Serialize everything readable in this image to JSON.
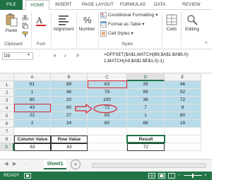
{
  "ribbon_tabs": {
    "file": "FILE",
    "home": "HOME",
    "insert": "INSERT",
    "page_layout": "PAGE LAYOUT",
    "formulas": "FORMULAS",
    "data": "DATA",
    "review": "REVIEW"
  },
  "clipboard": {
    "paste": "Paste",
    "label": "Clipboard"
  },
  "font": {
    "label": "Font"
  },
  "alignment": {
    "label": "Alignment"
  },
  "number": {
    "label": "Number"
  },
  "styles": {
    "conditional_formatting": "Conditional Formatting",
    "format_as_table": "Format as Table",
    "cell_styles": "Cell Styles",
    "label": "Styles"
  },
  "cells": {
    "label": "Cells"
  },
  "editing": {
    "label": "Editing"
  },
  "formula_bar": {
    "name_box": "D9",
    "formula_line1": "=OFFSET($A$1,MATCH(B9,$A$1:$A$6,0)-",
    "formula_line2": "1,MATCH(A9,$A$1:$E$1,0)-1)"
  },
  "columns": [
    "A",
    "B",
    "C",
    "D",
    "E"
  ],
  "rows": [
    {
      "num": "1",
      "cells": [
        "61",
        "89",
        "63",
        "26",
        "46"
      ]
    },
    {
      "num": "2",
      "cells": [
        "1",
        "46",
        "79",
        "99",
        "92"
      ]
    },
    {
      "num": "3",
      "cells": [
        "80",
        "20",
        "100",
        "36",
        "72"
      ]
    },
    {
      "num": "4",
      "cells": [
        "43",
        "80",
        "72",
        "7",
        "8"
      ]
    },
    {
      "num": "5",
      "cells": [
        "22",
        "27",
        "83",
        "1",
        "80"
      ]
    },
    {
      "num": "6",
      "cells": [
        "2",
        "34",
        "60",
        "88",
        "18"
      ]
    },
    {
      "num": "7",
      "cells": [
        "",
        "",
        "",
        "",
        ""
      ]
    },
    {
      "num": "8",
      "cells": [
        "Column Value",
        "Row Value",
        "",
        "Result",
        ""
      ]
    },
    {
      "num": "9",
      "cells": [
        "63",
        "43",
        "",
        "72",
        ""
      ]
    }
  ],
  "sheet": {
    "tab": "Sheet1"
  },
  "status": {
    "ready": "READY"
  }
}
